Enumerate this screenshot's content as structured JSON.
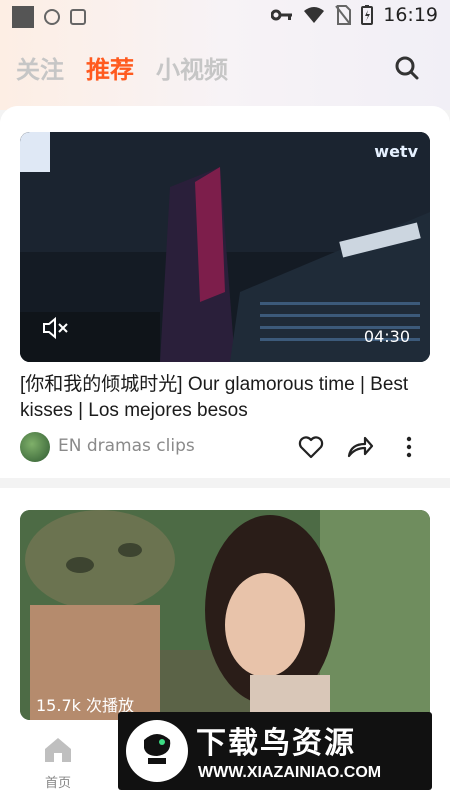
{
  "status_bar": {
    "time": "16:19"
  },
  "tabs": [
    {
      "label": "关注",
      "active": false
    },
    {
      "label": "推荐",
      "active": true
    },
    {
      "label": "小视频",
      "active": false
    }
  ],
  "feed": [
    {
      "duration": "04:30",
      "watermark": "wetv",
      "title": "[你和我的倾城时光] Our glamorous time | Best kisses | Los mejores besos",
      "channel": "EN  dramas clips"
    },
    {
      "plays": "15.7k 次播放"
    }
  ],
  "bottom_nav": {
    "home_label": "首页"
  },
  "promo": {
    "title": "下载鸟资源",
    "url": "WWW.XIAZAINIAO.COM"
  },
  "colors": {
    "accent": "#ff5a1f"
  },
  "icons": [
    "search-icon",
    "mute-icon",
    "heart-icon",
    "share-icon",
    "more-icon",
    "home-icon"
  ]
}
